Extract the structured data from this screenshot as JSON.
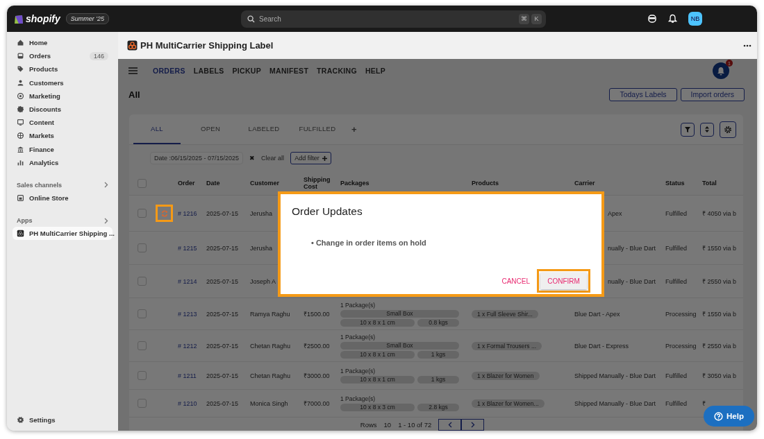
{
  "topbar": {
    "logo": "shopify",
    "edition": "Summer '25",
    "search": {
      "placeholder": "Search"
    },
    "shortcut": [
      "⌘",
      "K"
    ],
    "avatar": "NB"
  },
  "sidebar": {
    "items": [
      {
        "label": "Home",
        "selected": false
      },
      {
        "label": "Orders",
        "badge": "146",
        "selected": false
      },
      {
        "label": "Products",
        "selected": false
      },
      {
        "label": "Customers",
        "selected": false
      },
      {
        "label": "Marketing",
        "selected": false
      },
      {
        "label": "Discounts",
        "selected": false
      },
      {
        "label": "Content",
        "selected": false
      },
      {
        "label": "Markets",
        "selected": false
      },
      {
        "label": "Finance",
        "selected": false
      },
      {
        "label": "Analytics",
        "selected": false
      }
    ],
    "sections": [
      {
        "title": "Sales channels",
        "items": [
          {
            "label": "Online Store",
            "selected": false
          }
        ]
      },
      {
        "title": "Apps",
        "items": [
          {
            "label": "PH MultiCarrier Shipping ...",
            "selected": true
          }
        ]
      }
    ],
    "footer": {
      "label": "Settings"
    }
  },
  "app": {
    "title": "PH MultiCarrier Shipping Label",
    "nav": [
      {
        "label": "ORDERS",
        "selected": true
      },
      {
        "label": "LABELS",
        "selected": false
      },
      {
        "label": "PICKUP",
        "selected": false
      },
      {
        "label": "MANIFEST",
        "selected": false
      },
      {
        "label": "TRACKING",
        "selected": false
      },
      {
        "label": "HELP",
        "selected": false
      }
    ],
    "notification_count": "1",
    "heading": "All",
    "actions": [
      "Todays Labels",
      "Import orders"
    ],
    "tabs": [
      {
        "label": "ALL",
        "selected": true
      },
      {
        "label": "OPEN",
        "selected": false
      },
      {
        "label": "LABELED",
        "selected": false
      },
      {
        "label": "FULFILLED",
        "selected": false
      }
    ],
    "add_tab": "+",
    "filters": {
      "chip": "Date :06/15/2025 - 07/15/2025",
      "remove": "✖",
      "clear": "Clear all",
      "add": "Add filter"
    },
    "table": {
      "select_all_checked": false,
      "columns": [
        "Order",
        "Date",
        "Customer",
        "Shipping Cost",
        "Packages",
        "Products",
        "Carrier",
        "Status",
        "Total"
      ],
      "rows": [
        {
          "checked": false,
          "sync": true,
          "covered": true,
          "order": "# 1216",
          "date": "2025-07-15",
          "customer": "Jerusha",
          "carrier": "Apex",
          "status": "Fulfilled",
          "total": "₹ 4050 via b"
        },
        {
          "checked": false,
          "sync": false,
          "covered": true,
          "order": "# 1215",
          "date": "2025-07-15",
          "customer": "Jerusha",
          "carrier": "nually - Blue Dart",
          "status": "Fulfilled",
          "total": "₹ 1550 via b"
        },
        {
          "checked": false,
          "sync": false,
          "covered": true,
          "order": "# 1214",
          "date": "2025-07-15",
          "customer": "Joseph A",
          "carrier": "nually - Blue Dart",
          "status": "Fulfilled",
          "total": "₹ 2550 via b"
        },
        {
          "checked": false,
          "sync": false,
          "covered": false,
          "order": "# 1213",
          "date": "2025-07-15",
          "customer": "Ramya Raghu",
          "shipping_cost": "₹1500.00",
          "packages": {
            "count": "1 Package(s)",
            "box": "Small Box",
            "dims": "10 x 8 x 1 cm",
            "weight": "0.8 kgs"
          },
          "product": "1 x Full Sleeve Shir...",
          "carrier": "Blue Dart - Apex",
          "status": "Processing",
          "total": "₹ 1550 via b"
        },
        {
          "checked": false,
          "sync": false,
          "covered": false,
          "order": "# 1212",
          "date": "2025-07-15",
          "customer": "Chetan Raghu",
          "shipping_cost": "₹2500.00",
          "packages": {
            "count": "1 Package(s)",
            "box": "Small Box",
            "dims": "10 x 8 x 1 cm",
            "weight": "1 kgs"
          },
          "product": "1 x Formal Trousers ...",
          "carrier": "Blue Dart - Express",
          "status": "Processing",
          "total": "₹ 2550 via b"
        },
        {
          "checked": false,
          "sync": false,
          "covered": false,
          "order": "# 1211",
          "date": "2025-07-15",
          "customer": "Chetan Raghu",
          "shipping_cost": "₹3000.00",
          "packages": {
            "count": "1 Package(s)",
            "dims": "10 x 8 x 1 cm",
            "weight": "1 kgs"
          },
          "product": "1 x Blazer for Women",
          "carrier": "Shipped Manually - Blue Dart",
          "status": "Fulfilled",
          "total": "₹ 3050 via b"
        },
        {
          "checked": false,
          "sync": false,
          "covered": false,
          "order": "# 1210",
          "date": "2025-07-15",
          "customer": "Monica Singh",
          "shipping_cost": "₹7000.00",
          "packages": {
            "count": "1 Package(s)",
            "dims": "10 x 8 x 3 cm",
            "weight": "2.8 kgs"
          },
          "product": "1 x Blazer for Women...",
          "carrier": "Shipped Manually - Blue Dart",
          "status": "Fulfilled",
          "total": "₹"
        }
      ],
      "footer": {
        "rows_label": "Rows",
        "rows_value": "10",
        "range": "1 - 10 of 72"
      }
    },
    "modal": {
      "title": "Order Updates",
      "items": [
        "• Change in order items on hold"
      ],
      "cancel": "CANCEL",
      "confirm": "CONFIRM"
    },
    "help": "Help"
  }
}
